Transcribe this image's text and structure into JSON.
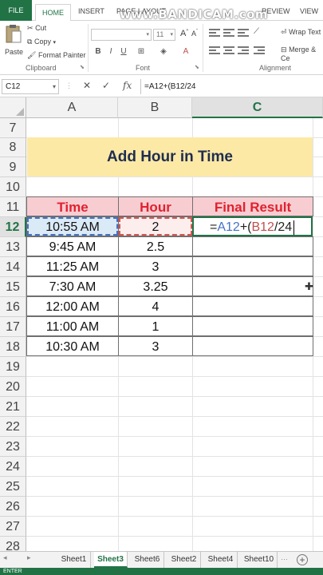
{
  "ribbon_tabs": {
    "file": "FILE",
    "home": "HOME",
    "insert": "INSERT",
    "page_layout": "PAGE LAYOUT",
    "review": "REVIEW",
    "view": "VIEW"
  },
  "watermark": "www.BANDICAM.com",
  "clipboard": {
    "paste": "Paste",
    "cut": "Cut",
    "copy": "Copy",
    "format_painter": "Format Painter",
    "label": "Clipboard"
  },
  "font": {
    "size": "11",
    "label": "Font"
  },
  "alignment": {
    "wrap_text": "Wrap Text",
    "merge": "Merge & Ce",
    "label": "Alignment"
  },
  "formula_bar": {
    "name_box": "C12",
    "formula": "=A12+(B12/24"
  },
  "columns": [
    "A",
    "B",
    "C"
  ],
  "rows": [
    "7",
    "8",
    "9",
    "10",
    "11",
    "12",
    "13",
    "14",
    "15",
    "16",
    "17",
    "18",
    "19",
    "20",
    "21",
    "22",
    "23",
    "24",
    "25",
    "26",
    "27",
    "28"
  ],
  "table": {
    "title": "Add Hour in Time",
    "headers": [
      "Time",
      "Hour",
      "Final Result"
    ],
    "rows": [
      {
        "time": "10:55 AM",
        "hour": "2"
      },
      {
        "time": "9:45 AM",
        "hour": "2.5"
      },
      {
        "time": "11:25 AM",
        "hour": "3"
      },
      {
        "time": "7:30 AM",
        "hour": "3.25"
      },
      {
        "time": "12:00 AM",
        "hour": "4"
      },
      {
        "time": "11:00 AM",
        "hour": "1"
      },
      {
        "time": "10:30 AM",
        "hour": "3"
      }
    ]
  },
  "editing_cell": {
    "eq": "=",
    "ref_a": "A12",
    "plus_paren": "+(",
    "ref_b": "B12",
    "tail": "/24"
  },
  "sheets": [
    "Sheet1",
    "Sheet3",
    "Sheet6",
    "Sheet2",
    "Sheet4",
    "Sheet10"
  ],
  "active_sheet": "Sheet3",
  "status": "ENTER"
}
